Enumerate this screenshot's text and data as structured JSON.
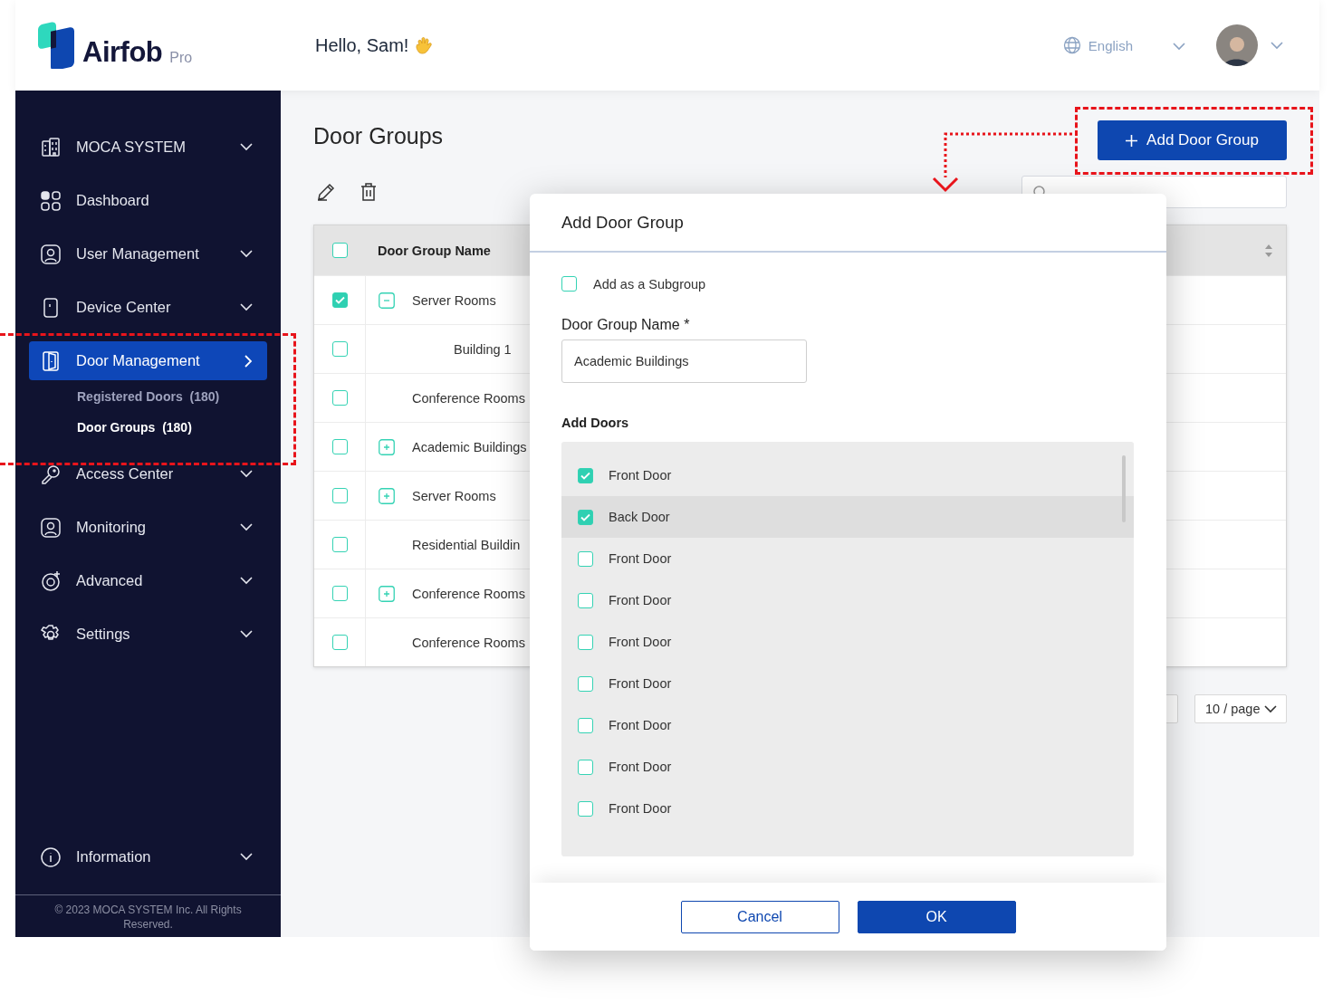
{
  "header": {
    "brand": "Airfob",
    "edition": "Pro",
    "greeting": "Hello, Sam!",
    "language": "English"
  },
  "sidebar": {
    "items": [
      {
        "label": "MOCA SYSTEM",
        "kind": "menu",
        "selected": false
      },
      {
        "label": "Dashboard",
        "kind": "link",
        "selected": false
      },
      {
        "label": "User Management",
        "kind": "menu",
        "selected": false
      },
      {
        "label": "Device Center",
        "kind": "menu",
        "selected": false
      },
      {
        "label": "Door Management",
        "kind": "menu",
        "selected": true,
        "children": [
          {
            "label": "Registered Doors",
            "count": "(180)",
            "selected": false
          },
          {
            "label": "Door Groups",
            "count": "(180)",
            "selected": true
          }
        ]
      },
      {
        "label": "Access Center",
        "kind": "menu",
        "selected": false
      },
      {
        "label": "Monitoring",
        "kind": "menu",
        "selected": false
      },
      {
        "label": "Advanced",
        "kind": "menu",
        "selected": false
      },
      {
        "label": "Settings",
        "kind": "menu",
        "selected": false
      }
    ],
    "bottom_item": {
      "label": "Information",
      "kind": "menu",
      "selected": false
    },
    "footer": "© 2023 MOCA SYSTEM Inc. All Rights Reserved."
  },
  "page": {
    "title": "Door Groups",
    "add_button": "Add Door Group",
    "table": {
      "columns": [
        "Door Group Name"
      ],
      "header_checked": false,
      "rows": [
        {
          "name": "Server Rooms",
          "checked": true,
          "expandable": true,
          "expanded": true,
          "children": [
            {
              "name": "Building 1",
              "checked": false,
              "expandable": false
            }
          ]
        },
        {
          "name": "Conference Rooms",
          "checked": false,
          "expandable": false
        },
        {
          "name": "Academic Buildings",
          "checked": false,
          "expandable": true,
          "expanded": false
        },
        {
          "name": "Server Rooms",
          "checked": false,
          "expandable": true,
          "expanded": false
        },
        {
          "name": "Residential Buildin",
          "checked": false,
          "expandable": false
        },
        {
          "name": "Conference Rooms",
          "checked": false,
          "expandable": true,
          "expanded": false
        },
        {
          "name": "Conference Rooms",
          "checked": false,
          "expandable": false
        }
      ]
    },
    "page_size": "10 / page"
  },
  "dialog": {
    "title": "Add Door Group",
    "subgroup": {
      "label": "Add as a Subgroup",
      "checked": false
    },
    "name_field": {
      "label": "Door Group Name *",
      "value": "Academic Buildings"
    },
    "doors_label": "Add Doors",
    "doors": [
      {
        "name": "Front Door",
        "checked": true,
        "highlighted": false
      },
      {
        "name": "Back Door",
        "checked": true,
        "highlighted": true
      },
      {
        "name": "Front Door",
        "checked": false,
        "highlighted": false
      },
      {
        "name": "Front Door",
        "checked": false,
        "highlighted": false
      },
      {
        "name": "Front Door",
        "checked": false,
        "highlighted": false
      },
      {
        "name": "Front Door",
        "checked": false,
        "highlighted": false
      },
      {
        "name": "Front Door",
        "checked": false,
        "highlighted": false
      },
      {
        "name": "Front Door",
        "checked": false,
        "highlighted": false
      },
      {
        "name": "Front Door",
        "checked": false,
        "highlighted": false
      }
    ],
    "buttons": [
      {
        "label": "Cancel",
        "kind": "secondary"
      },
      {
        "label": "OK",
        "kind": "primary"
      }
    ]
  }
}
